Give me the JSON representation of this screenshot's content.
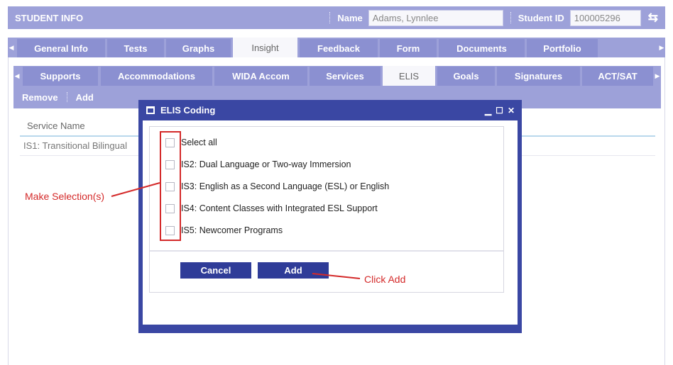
{
  "header": {
    "title": "STUDENT INFO",
    "name_label": "Name",
    "name_value": "Adams, Lynnlee",
    "id_label": "Student ID",
    "id_value": "100005296",
    "refresh_icon": "refresh-icon"
  },
  "main_tabs": [
    "General Info",
    "Tests",
    "Graphs",
    "Insight",
    "Feedback",
    "Form",
    "Documents",
    "Portfolio"
  ],
  "main_tab_active": "Insight",
  "sub_tabs": [
    "Supports",
    "Accommodations",
    "WIDA Accom",
    "Services",
    "ELIS",
    "Goals",
    "Signatures",
    "ACT/SAT"
  ],
  "sub_tab_active": "ELIS",
  "actions": {
    "remove": "Remove",
    "add": "Add"
  },
  "grid": {
    "header": "Service Name",
    "rows": [
      "IS1: Transitional Bilingual"
    ]
  },
  "modal": {
    "title": "ELIS Coding",
    "options": [
      "Select all",
      "IS2: Dual Language or Two-way Immersion",
      "IS3: English as a Second Language (ESL) or English",
      "IS4: Content Classes with Integrated ESL Support",
      "IS5: Newcomer Programs"
    ],
    "cancel_label": "Cancel",
    "add_label": "Add"
  },
  "annotations": {
    "selection_note": "Make Selection(s)",
    "add_note": "Click Add",
    "color": "#d42a2a"
  },
  "colors": {
    "bar": "#9da1d9",
    "tab": "#8b90d1",
    "modal_frame": "#3a47a3",
    "button": "#2f3c98"
  }
}
